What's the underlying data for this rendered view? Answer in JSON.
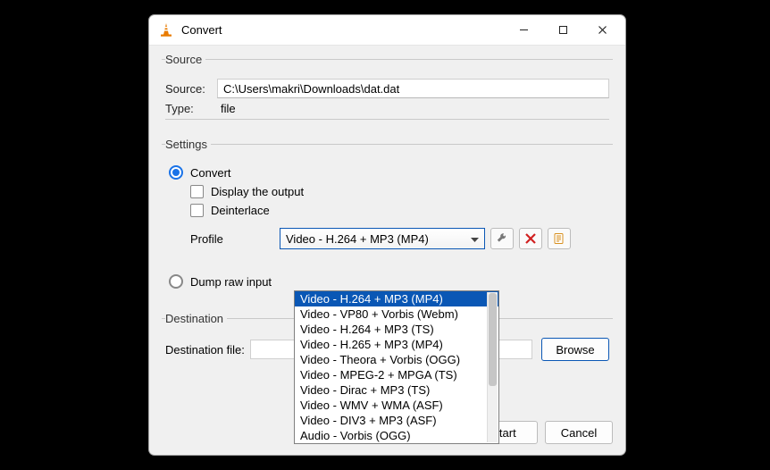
{
  "window": {
    "title": "Convert"
  },
  "source": {
    "legend": "Source",
    "source_label": "Source:",
    "source_value": "C:\\Users\\makri\\Downloads\\dat.dat",
    "type_label": "Type:",
    "type_value": "file"
  },
  "settings": {
    "legend": "Settings",
    "convert_label": "Convert",
    "display_output_label": "Display the output",
    "deinterlace_label": "Deinterlace",
    "profile_label": "Profile",
    "profile_selected": "Video - H.264 + MP3 (MP4)",
    "profile_options": [
      "Video - H.264 + MP3 (MP4)",
      "Video - VP80 + Vorbis (Webm)",
      "Video - H.264 + MP3 (TS)",
      "Video - H.265 + MP3 (MP4)",
      "Video - Theora + Vorbis (OGG)",
      "Video - MPEG-2 + MPGA (TS)",
      "Video - Dirac + MP3 (TS)",
      "Video - WMV + WMA (ASF)",
      "Video - DIV3 + MP3 (ASF)",
      "Audio - Vorbis (OGG)"
    ],
    "dump_raw_label": "Dump raw input"
  },
  "destination": {
    "legend": "Destination",
    "file_label": "Destination file:",
    "file_value": "",
    "browse_label": "Browse"
  },
  "footer": {
    "start_label": "Start",
    "cancel_label": "Cancel"
  },
  "icons": {
    "wrench": "wrench-icon",
    "delete": "delete-icon",
    "new": "new-profile-icon"
  }
}
